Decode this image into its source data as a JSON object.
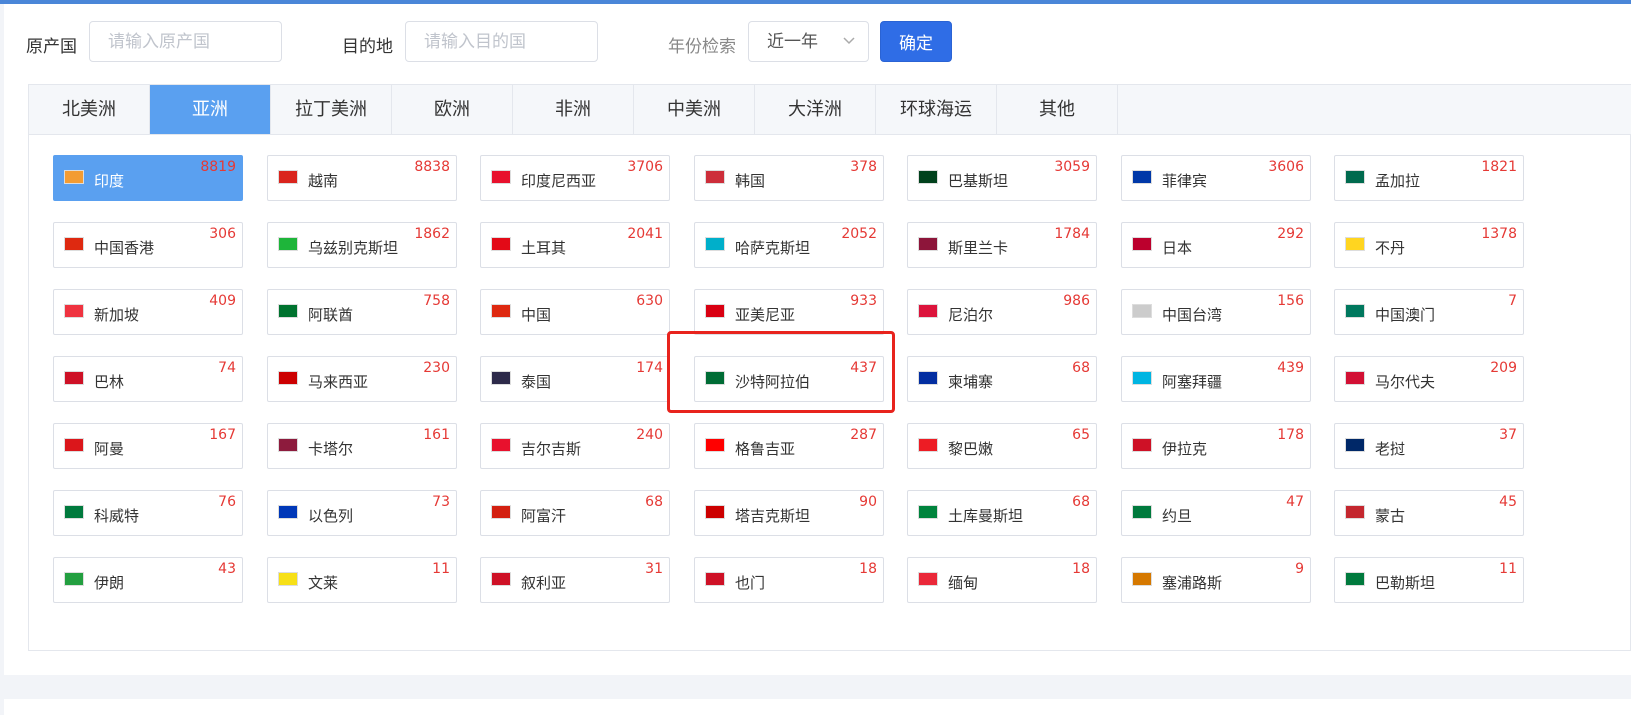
{
  "search": {
    "origin_label": "原产国",
    "origin_placeholder": "请输入原产国",
    "dest_label": "目的地",
    "dest_placeholder": "请输入目的国",
    "year_label": "年份检索",
    "year_value": "近一年",
    "confirm_label": "确定"
  },
  "tabs": [
    {
      "label": "北美洲",
      "active": false
    },
    {
      "label": "亚洲",
      "active": true
    },
    {
      "label": "拉丁美洲",
      "active": false
    },
    {
      "label": "欧洲",
      "active": false
    },
    {
      "label": "非洲",
      "active": false
    },
    {
      "label": "中美洲",
      "active": false
    },
    {
      "label": "大洋洲",
      "active": false
    },
    {
      "label": "环球海运",
      "active": false
    },
    {
      "label": "其他",
      "active": false
    }
  ],
  "countries": [
    {
      "name": "印度",
      "count": "8819",
      "flag": "#f39c33",
      "active": true
    },
    {
      "name": "越南",
      "count": "8838",
      "flag": "#da251d"
    },
    {
      "name": "印度尼西亚",
      "count": "3706",
      "flag": "#e8112d"
    },
    {
      "name": "韩国",
      "count": "378",
      "flag": "#cd2e3a"
    },
    {
      "name": "巴基斯坦",
      "count": "3059",
      "flag": "#01411c"
    },
    {
      "name": "菲律宾",
      "count": "3606",
      "flag": "#0038a8"
    },
    {
      "name": "孟加拉",
      "count": "1821",
      "flag": "#006a4e"
    },
    {
      "name": "中国香港",
      "count": "306",
      "flag": "#de2910"
    },
    {
      "name": "乌兹别克斯坦",
      "count": "1862",
      "flag": "#1eb53a"
    },
    {
      "name": "土耳其",
      "count": "2041",
      "flag": "#e30a17"
    },
    {
      "name": "哈萨克斯坦",
      "count": "2052",
      "flag": "#00afca"
    },
    {
      "name": "斯里兰卡",
      "count": "1784",
      "flag": "#8d153a"
    },
    {
      "name": "日本",
      "count": "292",
      "flag": "#bc002d"
    },
    {
      "name": "不丹",
      "count": "1378",
      "flag": "#ffd520"
    },
    {
      "name": "新加坡",
      "count": "409",
      "flag": "#ef3340"
    },
    {
      "name": "阿联酋",
      "count": "758",
      "flag": "#00732f"
    },
    {
      "name": "中国",
      "count": "630",
      "flag": "#de2910"
    },
    {
      "name": "亚美尼亚",
      "count": "933",
      "flag": "#d90012"
    },
    {
      "name": "尼泊尔",
      "count": "986",
      "flag": "#dc143c"
    },
    {
      "name": "中国台湾",
      "count": "156",
      "flag": "#cccccc"
    },
    {
      "name": "中国澳门",
      "count": "7",
      "flag": "#00785e"
    },
    {
      "name": "巴林",
      "count": "74",
      "flag": "#ce1126"
    },
    {
      "name": "马来西亚",
      "count": "230",
      "flag": "#cc0001"
    },
    {
      "name": "泰国",
      "count": "174",
      "flag": "#2d2a4a"
    },
    {
      "name": "沙特阿拉伯",
      "count": "437",
      "flag": "#006c35"
    },
    {
      "name": "柬埔寨",
      "count": "68",
      "flag": "#032ea1"
    },
    {
      "name": "阿塞拜疆",
      "count": "439",
      "flag": "#00b5e2"
    },
    {
      "name": "马尔代夫",
      "count": "209",
      "flag": "#d21034"
    },
    {
      "name": "阿曼",
      "count": "167",
      "flag": "#db161b"
    },
    {
      "name": "卡塔尔",
      "count": "161",
      "flag": "#8d1b3d"
    },
    {
      "name": "吉尔吉斯",
      "count": "240",
      "flag": "#e8112d"
    },
    {
      "name": "格鲁吉亚",
      "count": "287",
      "flag": "#ff0000"
    },
    {
      "name": "黎巴嫩",
      "count": "65",
      "flag": "#ed1c24"
    },
    {
      "name": "伊拉克",
      "count": "178",
      "flag": "#ce1126"
    },
    {
      "name": "老挝",
      "count": "37",
      "flag": "#002868"
    },
    {
      "name": "科威特",
      "count": "76",
      "flag": "#007a3d"
    },
    {
      "name": "以色列",
      "count": "73",
      "flag": "#0038b8"
    },
    {
      "name": "阿富汗",
      "count": "68",
      "flag": "#d32011"
    },
    {
      "name": "塔吉克斯坦",
      "count": "90",
      "flag": "#cc0000"
    },
    {
      "name": "土库曼斯坦",
      "count": "68",
      "flag": "#00843d"
    },
    {
      "name": "约旦",
      "count": "47",
      "flag": "#007a3d"
    },
    {
      "name": "蒙古",
      "count": "45",
      "flag": "#c4272f"
    },
    {
      "name": "伊朗",
      "count": "43",
      "flag": "#239f40"
    },
    {
      "name": "文莱",
      "count": "11",
      "flag": "#f7e017"
    },
    {
      "name": "叙利亚",
      "count": "31",
      "flag": "#ce1126"
    },
    {
      "name": "也门",
      "count": "18",
      "flag": "#ce1126"
    },
    {
      "name": "缅甸",
      "count": "18",
      "flag": "#ea2839"
    },
    {
      "name": "塞浦路斯",
      "count": "9",
      "flag": "#d57800"
    },
    {
      "name": "巴勒斯坦",
      "count": "11",
      "flag": "#007a3d"
    }
  ]
}
